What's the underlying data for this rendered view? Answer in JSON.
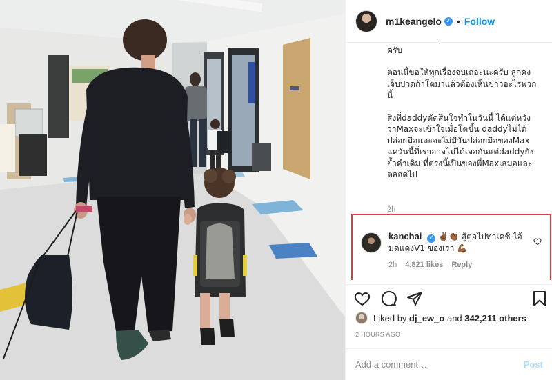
{
  "post": {
    "username": "m1keangelo",
    "verified": true,
    "separator": "•",
    "follow_label": "Follow",
    "caption_paragraphs": [
      "ผมหามาไปถึงลูกชายเพียงคนเดียวของผม ครับ",
      "ตอนนี้ขอให้ทุกเรื่องจบเถอะนะครับ ลูกคง เจ็บปวดถ้าโตมาแล้วต้องเห็นข่าวอะไรพวก นี้",
      "สิ่งที่daddyตัดสินใจทำในวันนี้ ได้แต่หวัง ว่าMaxจะเข้าใจเมื่อโตขึ้น daddyไม่ได้ ปล่อยมือและจะไม่มีวันปล่อยมือของMax แควันนี้ที่เราอาจไม่ได้เจอกันแต่daddyยัง ย้ำคำเดิม ที่ตรงนี้เป็นของพี่Maxเสมอและ ตลอดไป"
    ],
    "caption_time": "2h"
  },
  "highlighted_comment": {
    "username": "kanchai",
    "verified": true,
    "text_emoji_1": "✌🏾👏🏾",
    "text": "สู้ต่อไปทาเคชิ ไอ้ มดแดงV1 ของเรา",
    "text_emoji_2": "💪🏾",
    "time": "2h",
    "likes": "4,821 likes",
    "reply_label": "Reply",
    "box_color": "#e0393e"
  },
  "actions": {
    "like_icon": "heart-icon",
    "comment_icon": "comment-icon",
    "share_icon": "share-icon",
    "save_icon": "bookmark-icon"
  },
  "likes": {
    "prefix": "Liked by",
    "liker": "dj_ew_o",
    "and": "and",
    "count": "342,211 others"
  },
  "time_ago": "2 HOURS AGO",
  "add_comment": {
    "placeholder": "Add a comment…",
    "post_label": "Post"
  },
  "colors": {
    "link_blue": "#0095f6",
    "muted": "#8e8e8e",
    "post_disabled": "#b2dffc"
  }
}
